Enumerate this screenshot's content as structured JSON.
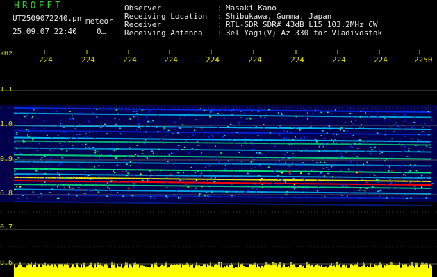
{
  "header": {
    "app_title": "HROFFT",
    "file_name": "UT2509072240.pn",
    "mode": "meteor",
    "timestamp": "25.09.07 22:40",
    "zoom": "0…",
    "info_rows": [
      {
        "label": "Observer",
        "value": "Masaki Kano"
      },
      {
        "label": "Receiving Location",
        "value": "Shibukawa, Gunma, Japan"
      },
      {
        "label": "Receiver",
        "value": "RTL-SDR SDR# 43dB L15 103.2MHz CW"
      },
      {
        "label": "Receiving Antenna",
        "value": "3el Yagi(V) Az 330 for Vladivostok"
      }
    ]
  },
  "chart_data": {
    "type": "heatmap",
    "y_unit": "kHz",
    "x_ticks": [
      "224",
      "224",
      "224",
      "224",
      "224",
      "224",
      "224",
      "224",
      "224",
      "2250"
    ],
    "y_ticks": [
      "1.1",
      "1.0",
      "0.9",
      "0.8",
      "0.7",
      "0.6"
    ],
    "ylim": [
      0.6,
      1.1
    ],
    "colormap": [
      "#00008b",
      "#0030ff",
      "#00c8ff",
      "#00ff80",
      "#ffff00",
      "#ff0000"
    ],
    "noise_color": "#ffff00"
  }
}
